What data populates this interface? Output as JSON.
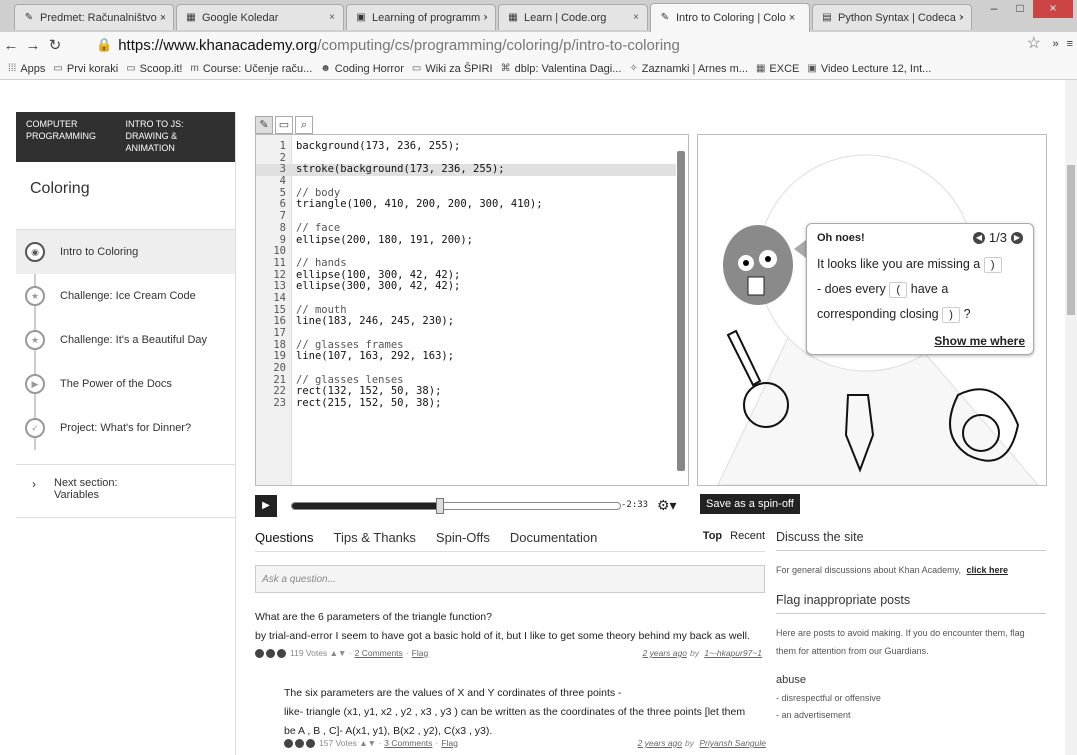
{
  "tabs": [
    {
      "icon": "khan-icon",
      "label": "Predmet: Računalništvo ×",
      "active": false
    },
    {
      "icon": "calendar-icon",
      "label": "Google Koledar",
      "active": false
    },
    {
      "icon": "page-icon",
      "label": "Learning of programm ×",
      "active": false
    },
    {
      "icon": "page-icon",
      "label": "Learn | Code.org",
      "active": false
    },
    {
      "icon": "khan-icon",
      "label": "Intro to Coloring | Colo ×",
      "active": true
    },
    {
      "icon": "page-icon",
      "label": "Python Syntax | Codeca ×",
      "active": false
    }
  ],
  "address": {
    "scheme": "https://",
    "host": "www.khanacademy.org",
    "path": "/computing/cs/programming/coloring/p/intro-to-coloring"
  },
  "bookmarks": [
    "Apps",
    "Prvi koraki",
    "Scoop.it!",
    "Course: Učenje raču...",
    "Coding Horror",
    "Wiki za ŠPIRI",
    "dblp: Valentina Dagi...",
    "Zaznamki | Arnes m...",
    "EXCE",
    "Video Lecture 12, Int..."
  ],
  "leftnav": {
    "crumb1": "COMPUTER PROGRAMMING",
    "crumb2": "INTRO TO JS: DRAWING & ANIMATION",
    "section": "Coloring",
    "lessons": [
      "Intro to Coloring",
      "Challenge: Ice Cream Code",
      "Challenge: It's a Beautiful Day",
      "The Power of the Docs",
      "Project: What's for Dinner?"
    ],
    "next_label": "Next section:",
    "next_name": "Variables"
  },
  "code_lines": [
    "background(173, 236, 255);",
    "",
    "stroke(background(173, 236, 255);",
    "",
    "// body",
    "triangle(100, 410, 200, 200, 300, 410);",
    "",
    "// face",
    "ellipse(200, 180, 191, 200);",
    "",
    "// hands",
    "ellipse(100, 300, 42, 42);",
    "ellipse(300, 300, 42, 42);",
    "",
    "// mouth",
    "line(183, 246, 245, 230);",
    "",
    "// glasses frames",
    "line(107, 163, 292, 163);",
    "",
    "// glasses lenses",
    "rect(132, 152, 50, 38);",
    "rect(215, 152, 50, 38);"
  ],
  "error": {
    "title": "Oh noes!",
    "page": "1/3",
    "l1": "It looks like you are missing a",
    "l2a": "- does every",
    "l2b": "have a",
    "l3": "corresponding closing",
    "q": "?",
    "close_paren": ")",
    "open_paren": "(",
    "show": "Show me where"
  },
  "player": {
    "time": "-2:33",
    "progress": 0.45,
    "spinoff": "Save as a spin-off"
  },
  "qtabs": [
    "Questions",
    "Tips & Thanks",
    "Spin-Offs",
    "Documentation"
  ],
  "sort": {
    "top": "Top",
    "recent": "Recent"
  },
  "ask_placeholder": "Ask a question...",
  "question": {
    "title": "What are the 6 parameters of the triangle function?",
    "body": "by trial-and-error I seem to have got a basic hold of it, but I like to get some theory behind my back as well.",
    "votes": "119 Votes",
    "comments": "2 Comments",
    "flag": "Flag",
    "age": "2 years ago",
    "by": "by",
    "author": "1~-hkapur97~1"
  },
  "answer": {
    "l1": "The six parameters are the values of X and Y cordinates of three points -",
    "l2": "like- triangle (x1, y1, x2 , y2 , x3 , y3 ) can be written as the coordinates of the three points [let them",
    "l3": "be A , B , C]- A(x1, y1), B(x2 , y2), C(x3 , y3).",
    "votes": "157 Votes",
    "comments": "3 Comments",
    "flag": "Flag",
    "age": "2 years ago",
    "by": "by",
    "author": "Priyansh Sangule"
  },
  "side": {
    "h1": "Discuss the site",
    "p1a": "For general discussions about Khan Academy,",
    "p1b": "click here",
    "h2": "Flag inappropriate posts",
    "p2": "Here are posts to avoid making. If you do encounter them, flag them for attention from our Guardians.",
    "h3": "abuse",
    "items": [
      "- disrespectful or offensive",
      "- an advertisement"
    ]
  }
}
